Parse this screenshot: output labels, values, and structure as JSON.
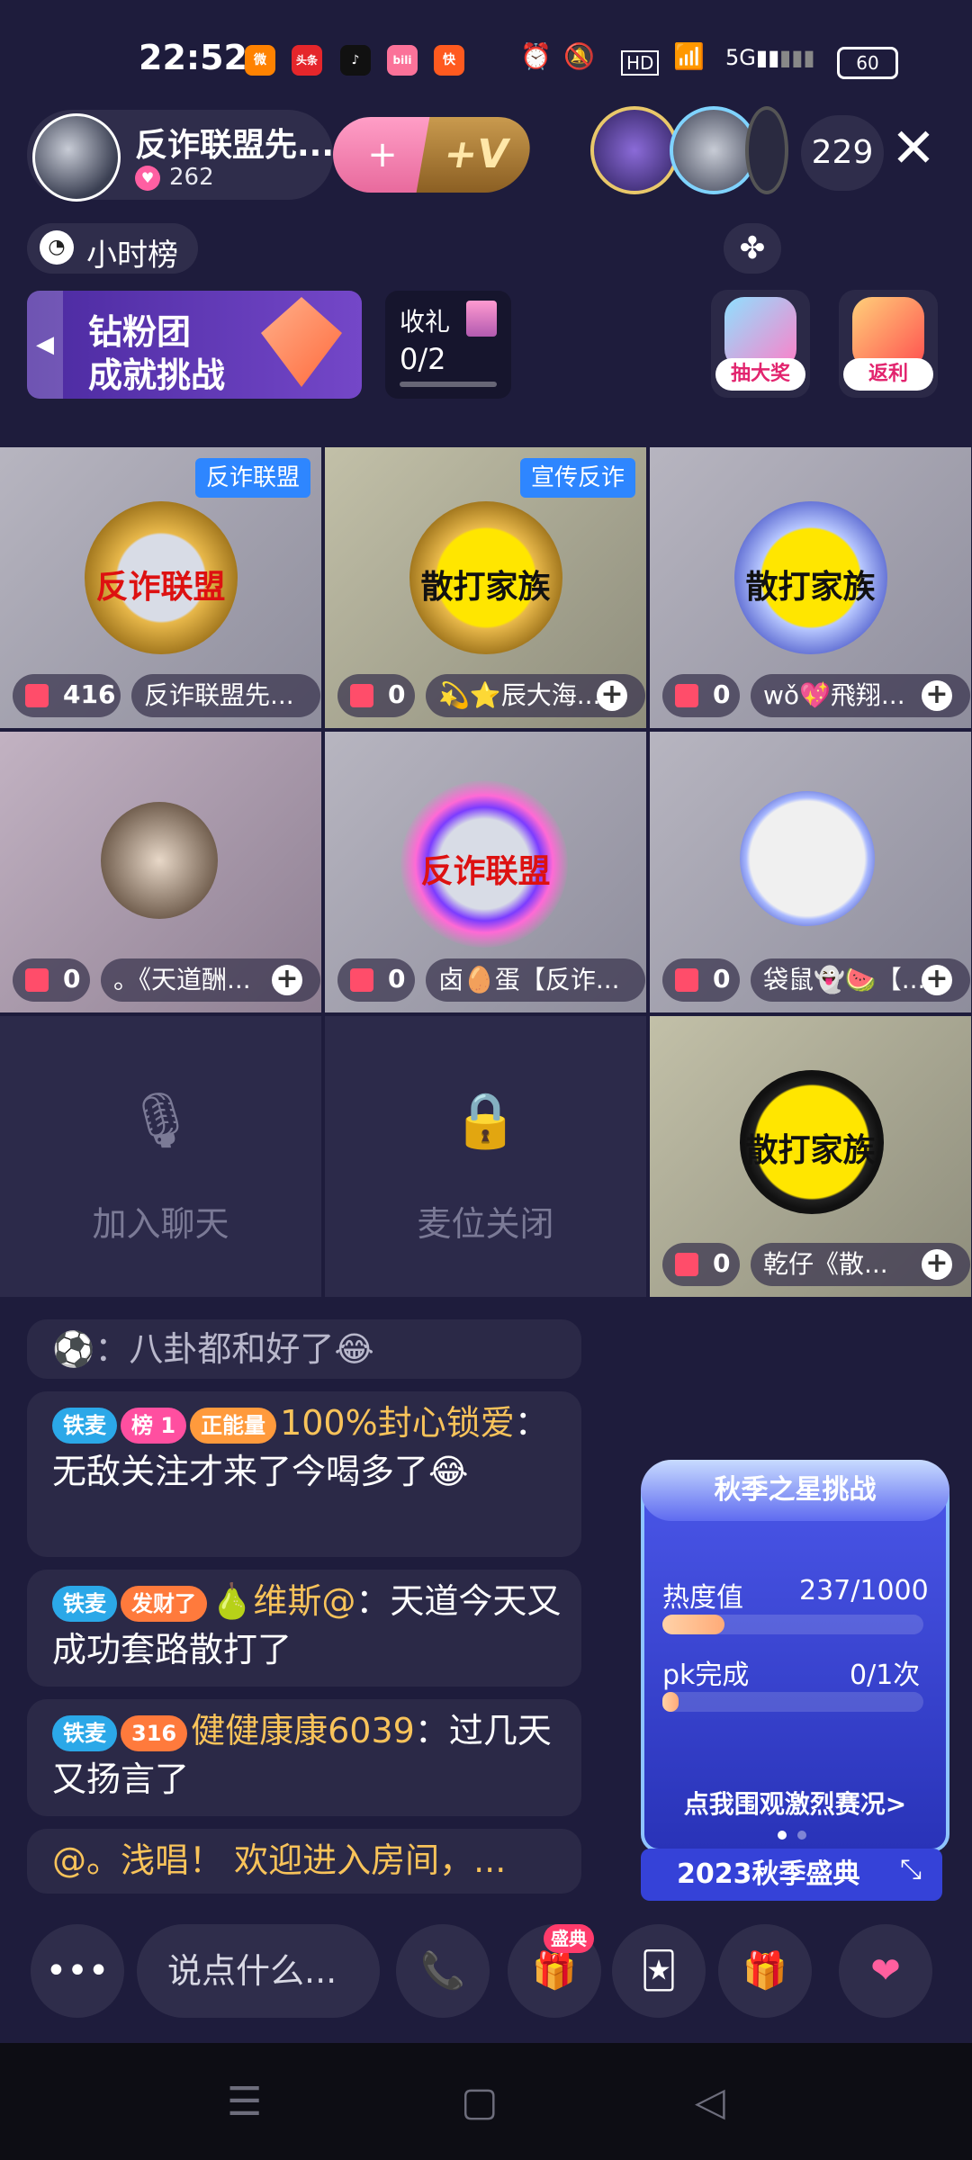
{
  "status_bar": {
    "time": "22:52",
    "apps": [
      {
        "name": "weibo-icon",
        "label": "微",
        "color": "#ff8200"
      },
      {
        "name": "toutiao-icon",
        "label": "头条",
        "color": "#e5262b"
      },
      {
        "name": "tiktok-icon",
        "label": "♪",
        "color": "#111111"
      },
      {
        "name": "bilibili-icon",
        "label": "bili",
        "color": "#fb7299"
      },
      {
        "name": "kuaishou-icon",
        "label": "快",
        "color": "#ff5a1f"
      }
    ],
    "battery": "60"
  },
  "header": {
    "room_name": "反诈联盟先...",
    "heat": "262",
    "viewer_count": "229",
    "fav_symbol": "+",
    "v_symbol": "+V",
    "close_symbol": "✕"
  },
  "rank": {
    "hour_rank": "小时榜",
    "challenge_line1": "钻粉团",
    "challenge_line2": "成就挑战",
    "gift_task_label": "收礼",
    "gift_task_value": "0/2",
    "lottery_label": "抽大奖",
    "rebate_label": "返利"
  },
  "seats": [
    {
      "tag": "反诈联盟",
      "emblem": "反诈联盟",
      "gifts": "416",
      "name": "反诈联盟先...",
      "follow": false
    },
    {
      "tag": "宣传反诈",
      "emblem": "散打家族",
      "gifts": "0",
      "name": "💫⭐辰大海...",
      "follow": true
    },
    {
      "tag": "",
      "emblem": "散打家族",
      "gifts": "0",
      "name": "wǒ💖飛翔...",
      "follow": true
    },
    {
      "tag": "",
      "emblem": "",
      "gifts": "0",
      "name": "。《天道酬...",
      "follow": true
    },
    {
      "tag": "",
      "emblem": "反诈联盟",
      "gifts": "0",
      "name": "卤🥚蛋【反诈...",
      "follow": false
    },
    {
      "tag": "",
      "emblem": "",
      "gifts": "0",
      "name": "袋鼠👻🍉【...",
      "follow": true
    },
    {
      "empty_label": "加入聊天"
    },
    {
      "empty_label": "麦位关闭"
    },
    {
      "tag": "",
      "emblem": "散打家族",
      "gifts": "0",
      "name": "乾仔《散...",
      "follow": true
    }
  ],
  "chat": {
    "first_user": "⚽",
    "first_msg": "：八卦都和好了😂",
    "msg1": {
      "badges": [
        "铁麦",
        "榜 1",
        "正能量"
      ],
      "user": "100%封心锁爱",
      "text": "：无敌关注才来了今喝多了😂"
    },
    "msg2": {
      "badges": [
        "铁麦",
        "发财了"
      ],
      "user": "🍐维斯@",
      "text": "：天道今天又成功套路散打了"
    },
    "msg3": {
      "badges": [
        "铁麦",
        "316"
      ],
      "user": "健健康康6039",
      "text": "：过几天又扬言了"
    },
    "msg4": {
      "text": "@。浅唱！  欢迎进入房间，..."
    }
  },
  "autumn": {
    "title": "秋季之星挑战",
    "heat_label": "热度值",
    "heat_value": "237/1000",
    "pk_label": "pk完成",
    "pk_value": "0/1次",
    "cta": "点我围观激烈赛况>",
    "gala": "2023秋季盛典",
    "heat_progress": 0.237,
    "pk_progress": 0.0
  },
  "bottom": {
    "more": "•••",
    "say_placeholder": "说点什么...",
    "gala_badge": "盛典"
  }
}
